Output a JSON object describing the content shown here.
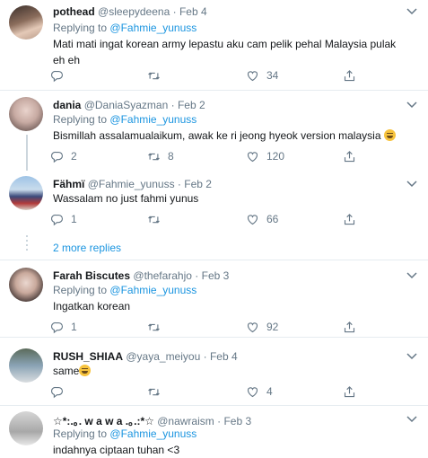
{
  "tweets": [
    {
      "name": "pothead",
      "handle": "@sleepydeena",
      "sep": "·",
      "date": "Feb 4",
      "text": "Mati mati ingat korean army lepastu aku cam pelik pehal Malaysia pulak eh eh",
      "replies": "",
      "retweets": "",
      "likes": "34"
    },
    {
      "name": "dania",
      "handle": "@DaniaSyazman",
      "sep": "·",
      "date": "Feb 2",
      "reply_prefix": "Replying to",
      "reply_to": "@Fahmie_yunuss",
      "text": "Bismillah assalamualaikum, awak ke ri jeong hyeok version malaysia",
      "replies": "2",
      "retweets": "8",
      "likes": "120"
    },
    {
      "name": "Fähmï",
      "handle": "@Fahmie_yunuss",
      "sep": "·",
      "date": "Feb 2",
      "text": "Wassalam no just fahmi yunus",
      "replies": "1",
      "retweets": "",
      "likes": "66"
    },
    {
      "name": "Farah Biscutes",
      "handle": "@thefarahjo",
      "sep": "·",
      "date": "Feb 3",
      "reply_prefix": "Replying to",
      "reply_to": "@Fahmie_yunuss",
      "text": "Ingatkan korean",
      "replies": "1",
      "retweets": "",
      "likes": "92"
    },
    {
      "name": "RUSH_SHIAA",
      "handle": "@yaya_meiyou",
      "sep": "·",
      "date": "Feb 4",
      "text": "same",
      "replies": "",
      "retweets": "",
      "likes": "4"
    },
    {
      "name": "☆*:.｡. w a w a .｡.:*☆",
      "handle": "@nawraism",
      "sep": "·",
      "date": "Feb 3",
      "reply_prefix": "Replying to",
      "reply_to": "@Fahmie_yunuss",
      "text": "indahnya ciptaan tuhan <3"
    }
  ],
  "first_tweet_reply": {
    "prefix": "Replying to",
    "mention": "@Fahmie_yunuss"
  },
  "more_replies": "2 more replies",
  "colors": {
    "accent": "#1b95e0",
    "muted": "#657786",
    "divider": "#e6ecf0"
  },
  "icons": [
    "reply-icon",
    "retweet-icon",
    "like-icon",
    "share-icon",
    "caret-down-icon",
    "laughing-emoji-icon"
  ]
}
